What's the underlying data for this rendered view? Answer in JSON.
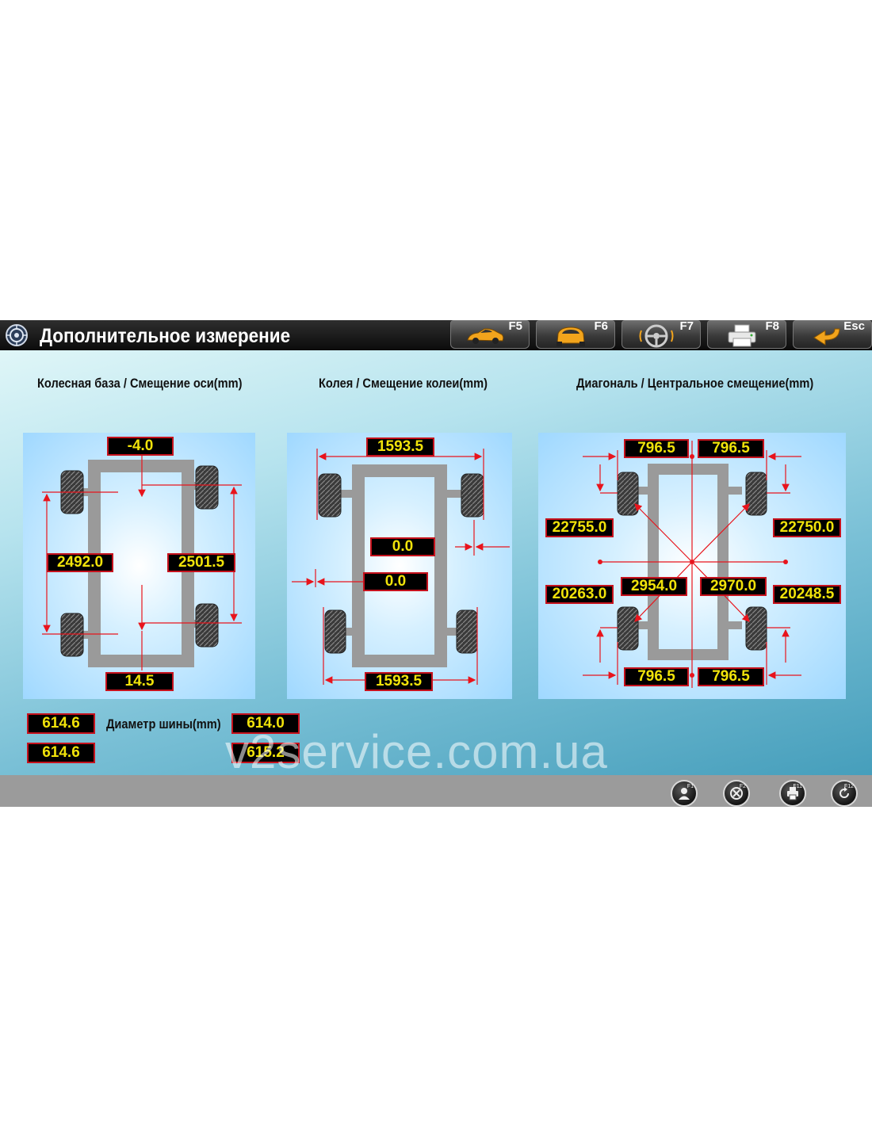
{
  "header": {
    "title": "Дополнительное измерение",
    "logo_icon": "aperture-logo-icon",
    "fkeys": [
      {
        "label": "F5",
        "icon": "sports-car-side-icon"
      },
      {
        "label": "F6",
        "icon": "car-front-icon"
      },
      {
        "label": "F7",
        "icon": "steering-wheel-icon"
      },
      {
        "label": "F8",
        "icon": "printer-icon"
      },
      {
        "label": "Esc",
        "icon": "return-arrow-icon"
      }
    ]
  },
  "sections": {
    "wheelbase": {
      "title": "Колесная база / Смещение оси(mm)",
      "top_offset": "-4.0",
      "left": "2492.0",
      "right": "2501.5",
      "bottom_offset": "14.5"
    },
    "track": {
      "title": "Колея / Смещение колеи(mm)",
      "top": "1593.5",
      "front_offset": "0.0",
      "rear_offset": "0.0",
      "bottom": "1593.5"
    },
    "diagonal": {
      "title": "Диагональ / Центральное смещение(mm)",
      "top_left": "796.5",
      "top_right": "796.5",
      "upper_left": "22755.0",
      "upper_right": "22750.0",
      "diag_left": "2954.0",
      "diag_right": "2970.0",
      "lower_left": "20263.0",
      "lower_right": "20248.5",
      "bottom_left": "796.5",
      "bottom_right": "796.5"
    }
  },
  "tire": {
    "label": "Диаметр шины(mm)",
    "front_left": "614.6",
    "rear_left": "614.6",
    "front_right": "614.0",
    "rear_right": "615.2"
  },
  "watermark": "v2service.com.ua",
  "footer": {
    "buttons": [
      {
        "tag": "F1",
        "icon": "user-icon"
      },
      {
        "tag": "F2",
        "icon": "tools-icon"
      },
      {
        "tag": "F11",
        "icon": "printer-icon"
      },
      {
        "tag": "F12",
        "icon": "back-icon"
      }
    ]
  },
  "colors": {
    "value_text": "#f0e20a",
    "value_border": "#c6121d",
    "dimension_line": "#e8141c"
  }
}
